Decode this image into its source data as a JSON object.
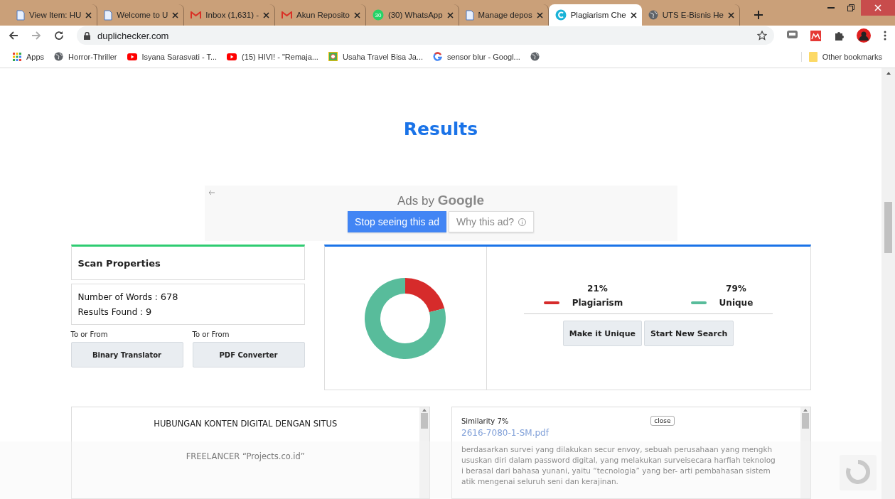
{
  "browser": {
    "tabs": [
      {
        "kind": "doc",
        "title": "View Item: HU",
        "selected": false
      },
      {
        "kind": "doc",
        "title": "Welcome to U",
        "selected": false
      },
      {
        "kind": "mail",
        "title": "Inbox (1,631) -",
        "selected": false
      },
      {
        "kind": "mail",
        "title": "Akun Reposito",
        "selected": false
      },
      {
        "kind": "chat",
        "badge": "30",
        "title": "(30) WhatsApp",
        "selected": false
      },
      {
        "kind": "doc",
        "title": "Manage depos",
        "selected": false
      },
      {
        "kind": "site",
        "title": "Plagiarism Che",
        "selected": true
      },
      {
        "kind": "globe",
        "title": "UTS E-Bisnis He",
        "selected": false
      }
    ],
    "address": "duplichecker.com",
    "bookmarks": [
      {
        "kind": "apps",
        "label": "Apps"
      },
      {
        "kind": "globe",
        "label": "Horror-Thriller"
      },
      {
        "kind": "video",
        "label": "Isyana Sarasvati - T..."
      },
      {
        "kind": "video",
        "label": "(15) HIVI! - \"Remaja..."
      },
      {
        "kind": "frame",
        "label": "Usaha Travel Bisa Ja..."
      },
      {
        "kind": "search",
        "label": "sensor blur - Googl..."
      },
      {
        "kind": "globe"
      }
    ],
    "other_bookmarks": "Other bookmarks"
  },
  "page": {
    "heading": "Results",
    "ad": {
      "label_prefix": "Ads by",
      "label_brand": "Google",
      "stop_button": "Stop seeing this ad",
      "why_button": "Why this ad?"
    },
    "scan": {
      "title": "Scan Properties",
      "stats": [
        {
          "label": "Number of Words :",
          "value": "678"
        },
        {
          "label": "Results Found :",
          "value": "9"
        }
      ],
      "tools": [
        {
          "caption": "To or From",
          "button": "Binary Translator"
        },
        {
          "caption": "To or From",
          "button": "PDF Converter"
        }
      ]
    },
    "result": {
      "chart_data": {
        "type": "donut",
        "categories": [
          "Plagiarism",
          "Unique"
        ],
        "values": [
          21,
          79
        ]
      },
      "legend": [
        {
          "percent": "21%",
          "color": "#d62b2b"
        },
        {
          "percent": "79%",
          "color": "#58bc9b"
        }
      ],
      "actions": [
        "Make it Unique",
        "Start New Search"
      ]
    },
    "source": {
      "lines": [
        "HUBUNGAN KONTEN DIGITAL DENGAN SITUS",
        "FREELANCER “Projects.co.id”"
      ]
    },
    "match": {
      "similarity": "Similarity 7%",
      "close": "close",
      "file": "2616-7080-1-SM.pdf",
      "excerpt": [
        "berdasarkan survei yang dilakukan secur envoy, sebuah perusahaan yang mengkh",
        "ususkan diri dalam password digital, yang melakukan surveisecara harfiah teknolog",
        "i berasal dari bahasa yunani, yaitu “tecnologia” yang ber- arti pembahasan sistem",
        "atik mengenai seluruh seni dan kerajinan."
      ]
    }
  }
}
